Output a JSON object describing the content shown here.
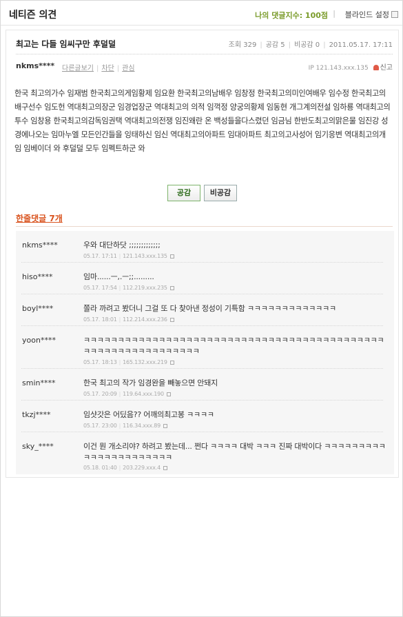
{
  "header": {
    "title": "네티즌 의견",
    "score_text": "나의 댓글지수: 100점",
    "blind_label": "블라인드 설정"
  },
  "post": {
    "title": "최고는 다들 임씨구만 후덜덜",
    "views": "조회 329",
    "agree": "공감 5",
    "disagree": "비공감 0",
    "datetime": "2011.05.17. 17:11",
    "author": "nkms****",
    "links": [
      "다른글보기",
      "차단",
      "관심"
    ],
    "ip": "IP 121.143.xxx.135",
    "report_label": "신고",
    "body": "한국 최고의가수 임재범 한국최고의게임황제 임요환 한국최고의남배우 임창정 한국최고의미인여배우 임수정 한국최고의배구선수 임도헌 역대최고의장군 임경업장군 역대최고의 의적 임꺽정 양궁의황제 임동현 개그계의전설 임하룡 역대최고의투수 임창용 한국최고의감독임권택 역대최고의전쟁 임진왜란 온 백성들을다스렸던 임금님 한반도최고의맑은물 임진강 성경에나오는 임마누엘 모든인간들을 잉태하신 임신 역대최고의아파트 임대아파트 최고의고사성어 임기응변 역대최고의개임 임베이더 와 후덜덜 모두 임펙트하군 와"
  },
  "buttons": {
    "agree_label": "공감",
    "disagree_label": "비공감"
  },
  "replies_heading": "한줄댓글 7개",
  "replies": [
    {
      "nick": "nkms****",
      "text": "우와 대단하닷 ;;;;;;;;;;;;;",
      "date": "05.17. 17:11",
      "ip": "121.143.xxx.135"
    },
    {
      "nick": "hiso****",
      "text": "임마......ㅡ,.ㅡ;;.........",
      "date": "05.17. 17:54",
      "ip": "112.219.xxx.235"
    },
    {
      "nick": "boyl****",
      "text": "쫄라 까려고 봤더니 그걸 또 다 찾아낸 정성이 기특함 ㅋㅋㅋㅋㅋㅋㅋㅋㅋㅋㅋㅋㅋ",
      "date": "05.17. 18:01",
      "ip": "112.214.xxx.236"
    },
    {
      "nick": "yoon****",
      "text": "ㅋㅋㅋㅋㅋㅋㅋㅋㅋㅋㅋㅋㅋㅋㅋㅋㅋㅋㅋㅋㅋㅋㅋㅋㅋㅋㅋㅋㅋㅋㅋㅋㅋㅋㅋㅋㅋㅋㅋㅋㅋㅋㅋㅋㅋㅋㅋㅋㅋㅋㅋㅋㅋㅋㅋㅋㅋㅋㅋㅋㅋ",
      "date": "05.17. 18:13",
      "ip": "165.132.xxx.219"
    },
    {
      "nick": "smin****",
      "text": "한국 최고의 작가 임경완을 빼놓으면 안돼지",
      "date": "05.17. 20:09",
      "ip": "119.64.xxx.190"
    },
    {
      "nick": "tkzj****",
      "text": "임샷갓은 어딨음?? 어깨의최고봉 ㅋㅋㅋㅋ",
      "date": "05.17. 23:00",
      "ip": "116.34.xxx.89"
    },
    {
      "nick": "sky_****",
      "text": "이건 뭔 개소리야? 하려고 봤는데... 쩐다 ㅋㅋㅋㅋ 대박 ㅋㅋㅋ 진짜 대박이다 ㅋㅋㅋㅋㅋㅋㅋㅋㅋㅋㅋㅋㅋㅋㅋㅋㅋㅋㅋㅋㅋㅋ",
      "date": "05.18. 01:40",
      "ip": "203.229.xxx.4"
    }
  ]
}
